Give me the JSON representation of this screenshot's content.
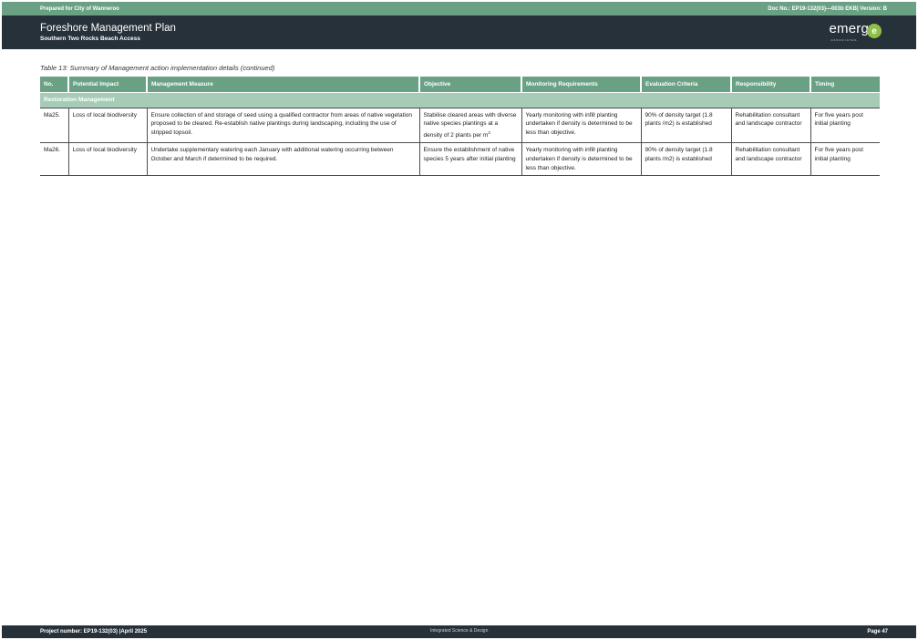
{
  "header": {
    "prepared_for": "Prepared for City of Wanneroo",
    "doc_info": "Doc No.: EP19-132(03)—003b EKB| Version: B",
    "title": "Foreshore Management Plan",
    "subtitle": "Southern Two Rocks Beach Access",
    "logo": {
      "text": "emerg",
      "mark": "e",
      "tagline": "ASSOCIATES",
      "brand_color": "#8dbf4a"
    }
  },
  "table": {
    "caption": "Table 13: Summary of Management action implementation details (continued)",
    "columns": [
      "No.",
      "Potential Impact",
      "Management Measure",
      "Objective",
      "Monitoring Requirements",
      "Evaluation Criteria",
      "Responsibility",
      "Timing"
    ],
    "section": "Restoration Management",
    "rows": [
      {
        "no": "Ma25.",
        "impact": "Loss of local biodiversity",
        "measure": "Ensure collection of and storage of seed using a qualified contractor from areas of native vegetation proposed to be cleared. Re-establish native plantings during landscaping, including the use of stripped topsoil.",
        "objective": "Stabilise cleared areas with diverse native species plantings at a density of 2 plants per m",
        "objective_sup": "2",
        "monitoring": "Yearly monitoring with infill planting undertaken if density is determined to be less than objective.",
        "evaluation": "90% of density target (1.8 plants /m2) is established",
        "responsibility": "Rehabilitation consultant and landscape contractor",
        "timing": "For five years post initial planting"
      },
      {
        "no": "Ma26.",
        "impact": "Loss of local biodiversity",
        "measure": "Undertake supplementary watering each January with additional watering occurring between October and March if determined to be required.",
        "objective": "Ensure the establishment of native species 5 years after initial planting",
        "monitoring": "Yearly monitoring with infill planting undertaken if density is determined to be less than objective.",
        "evaluation": "90% of density target (1.8 plants /m2) is established",
        "responsibility": "Rehabilitation consultant and landscape contractor",
        "timing": "For five years post initial planting"
      }
    ]
  },
  "footer": {
    "project": "Project number: EP19-132(03) |April 2025",
    "tagline": "Integrated Science & Design",
    "page": "Page 47"
  },
  "colors": {
    "accent_green": "#6aa184",
    "section_green": "#a6ccb7",
    "dark_band": "#27313a"
  }
}
